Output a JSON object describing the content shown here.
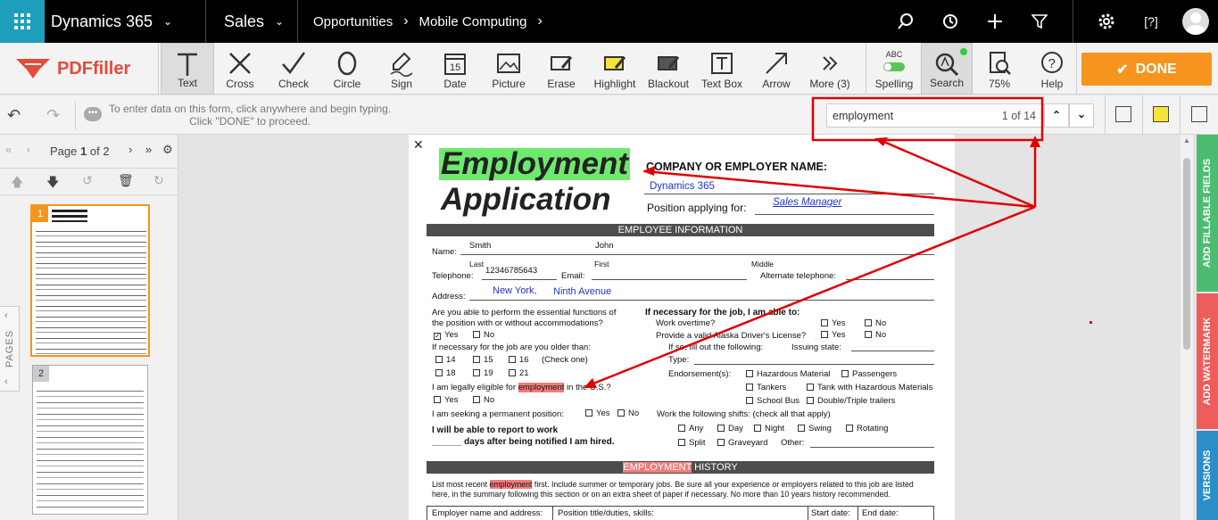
{
  "topbar": {
    "app_name": "Dynamics 365",
    "module": "Sales",
    "breadcrumb": [
      "Opportunities",
      "Mobile Computing"
    ]
  },
  "toolbar": {
    "logo": "PDFfiller",
    "tools": [
      "Text",
      "Cross",
      "Check",
      "Circle",
      "Sign",
      "Date",
      "Picture",
      "Erase",
      "Highlight",
      "Blackout",
      "Text Box",
      "Arrow",
      "More (3)"
    ],
    "spelling_label": "Spelling",
    "spelling_badge": "ABC",
    "search_label": "Search",
    "zoom_label": "75%",
    "help_label": "Help",
    "done_label": "DONE"
  },
  "infobar": {
    "hint_line1": "To enter data on this form, click anywhere and begin typing.",
    "hint_line2": "Click \"DONE\" to proceed.",
    "search_value": "employment",
    "search_count": "1 of 14"
  },
  "sidebar": {
    "page_label": "Page",
    "page_current": "1",
    "page_of": "of 2",
    "thumbs": [
      "1",
      "2"
    ],
    "pages_tab": "PAGES"
  },
  "rightrail": {
    "tab1": "ADD FILLABLE FIELDS",
    "tab2": "ADD WATERMARK",
    "tab3": "VERSIONS"
  },
  "document": {
    "title1": "Employment",
    "title2": "Application",
    "company_label": "COMPANY OR EMPLOYER NAME:",
    "company_value": "Dynamics 365",
    "position_label": "Position applying for:",
    "position_value": "Sales Manager",
    "section1": "EMPLOYEE INFORMATION",
    "name_label": "Name:",
    "last_value": "Smith",
    "first_value": "John",
    "last_label": "Last",
    "first_label": "First",
    "middle_label": "Middle",
    "tel_label": "Telephone:",
    "tel_value": "12346785643",
    "email_label": "Email:",
    "alt_tel_label": "Alternate telephone:",
    "address_label": "Address:",
    "address_value1": "New York,",
    "address_value2": "Ninth Avenue",
    "q1a": "Are you able to perform the essential functions of",
    "q1b": "the position with or without accommodations?",
    "yes": "Yes",
    "no": "No",
    "q2": "If necessary for the job are you older than:",
    "ages": [
      "14",
      "15",
      "16",
      "18",
      "19",
      "21"
    ],
    "check_one": "(Check one)",
    "q3_pre": "I am legally eligible for ",
    "q3_hl": "employment",
    "q3_post": " in the U.S.?",
    "q4": "I am seeking a permanent position:",
    "q5a": "I will be able to report to work",
    "q5b": "______ days after being notified I am hired.",
    "r_head": "If necessary for the job, I am able to:",
    "r_ot": "Work overtime?",
    "r_lic": "Provide a valid Alaska Driver's License?",
    "r_fill": "If so, fill out the following:",
    "r_state": "Issuing state:",
    "r_type": "Type:",
    "r_endorse": "Endorsement(s):",
    "endorsements": [
      "Hazardous Material",
      "Passengers",
      "Tankers",
      "Tank with Hazardous Materials",
      "School Bus",
      "Double/Triple trailers"
    ],
    "shifts_label": "Work the following shifts: (check all that apply)",
    "shifts": [
      "Any",
      "Day",
      "Night",
      "Swing",
      "Rotating",
      "Split",
      "Graveyard",
      "Other:"
    ],
    "section2_hl": "EMPLOYMENT",
    "section2_rest": " HISTORY",
    "hist_pre": "List most recent ",
    "hist_hl": "employment",
    "hist_post": " first. Include summer or temporary jobs. Be sure all your experience or employers related to this job are listed",
    "hist_line2": "here, in the summary following this section or on an extra sheet of paper if necessary. No more than 10 years history recommended.",
    "col1": "Employer name and address:",
    "col2": "Position title/duties, skills:",
    "col3": "Start date:",
    "col4": "End date:"
  },
  "colors": {
    "accent_teal": "#1e9ebd",
    "done_orange": "#f7941d",
    "annotation_red": "#e00000",
    "highlight_green": "#6ee96e",
    "highlight_red": "#f17b7b",
    "tab_green": "#4cbd70",
    "tab_red": "#ee5c5c",
    "tab_blue": "#2a8fc8"
  }
}
